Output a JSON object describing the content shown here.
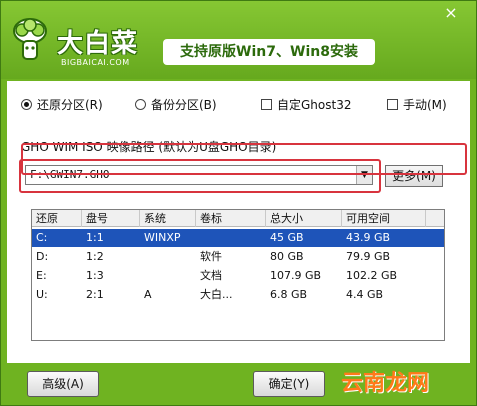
{
  "header": {
    "brand": "大白菜",
    "url": "BIGBAICAI.COM",
    "slogan": "支持原版Win7、Win8安装",
    "close": "×"
  },
  "options": {
    "restore": "还原分区(R)",
    "backup": "备份分区(B)",
    "custom_ghost": "自定Ghost32",
    "manual": "手动(M)"
  },
  "path_label": "GHO WIM ISO 映像路径 (默认为U盘GHO目录)",
  "combo": {
    "value": "F:\\GWIN7.GHO",
    "arrow": "▼"
  },
  "more_button": "更多(M)",
  "table": {
    "columns": [
      "还原",
      "盘号",
      "系统",
      "卷标",
      "总大小",
      "可用空间"
    ],
    "rows": [
      [
        "C:",
        "1:1",
        "WINXP",
        "",
        "45 GB",
        "43.9 GB"
      ],
      [
        "D:",
        "1:2",
        "",
        "软件",
        "80 GB",
        "79.9 GB"
      ],
      [
        "E:",
        "1:3",
        "",
        "文档",
        "107.9 GB",
        "102.2 GB"
      ],
      [
        "U:",
        "2:1",
        "A",
        "大白...",
        "6.8 GB",
        "4.4 GB"
      ]
    ],
    "selected_row": 0
  },
  "footer": {
    "advanced": "高级(A)",
    "ok": "确定(Y)",
    "watermark": "云南龙网"
  },
  "colors": {
    "window_green": "#6fb321",
    "selection_blue": "#1e54b9",
    "highlight_red": "#d8343e"
  }
}
